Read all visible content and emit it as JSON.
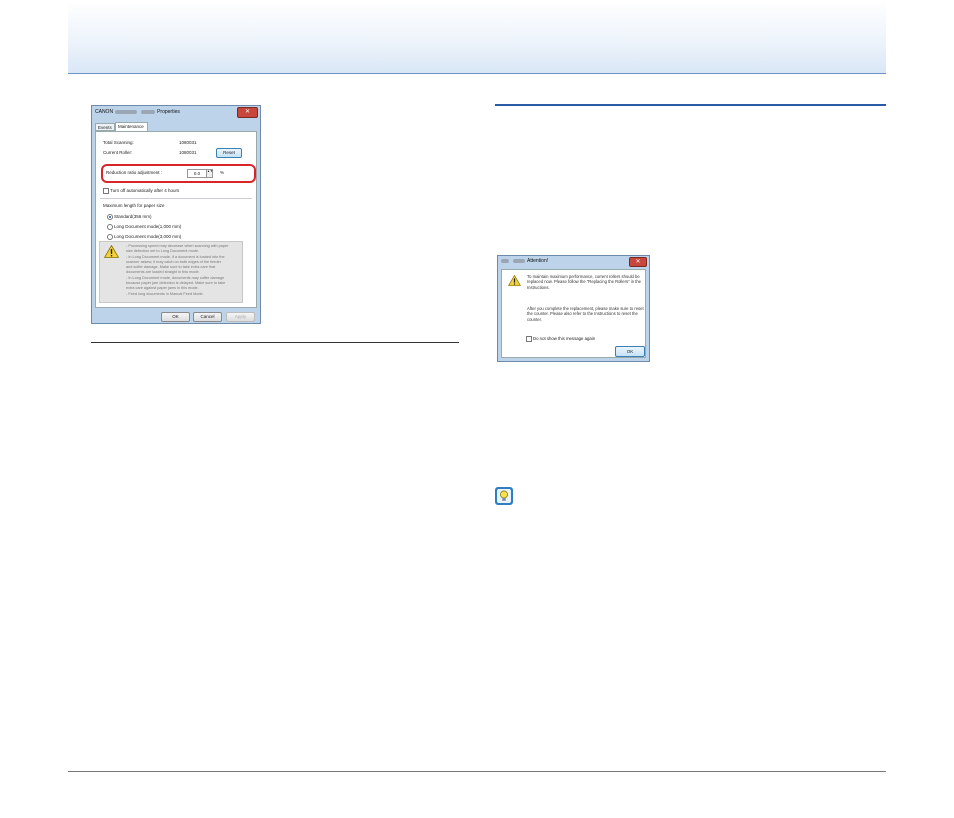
{
  "properties_dialog": {
    "title_left": "CANON",
    "title_right": "Properties",
    "close_label": "✕",
    "tabs": [
      "Events",
      "Maintenance"
    ],
    "total_scanning_label": "Total Scanning:",
    "total_scanning_value": "1080031",
    "current_rollers_label": "Current Roller:",
    "current_rollers_value": "1080031",
    "reset_label": "Reset",
    "reduction_label": "Reduction ratio adjustment :",
    "reduction_value": "0.0",
    "reduction_unit": "%",
    "spin_arrows": "▲▼",
    "auto_off_label": "Turn off automatically after 4 hours",
    "max_length_label": "Maximum length for paper size",
    "radio_options": [
      "Standard(356 mm)",
      "Long Document mode(1,000 mm)",
      "Long Document mode(3,000 mm)"
    ],
    "warning_lines": [
      "- Processing speed may decrease when scanning with paper",
      "size detection set to Long Document mode.",
      "- In Long Document mode, if a document is loaded into the",
      "scanner askew, it may catch on both edges of the feeder",
      "and suffer damage. Make sure to take extra care that",
      "documents are loaded straight in this mode.",
      "- In Long Document mode, documents may suffer damage",
      "because paper jam detection is delayed. Make sure to take",
      "extra care against paper jams in this mode.",
      "- Feed long documents in Manual Feed Mode."
    ],
    "buttons": [
      "OK",
      "Cancel",
      "Apply"
    ]
  },
  "attention_dialog": {
    "title": "Attention!",
    "close_label": "✕",
    "message_1": "To maintain maximum performance, current rollers should be replaced now. Please follow the \"Replacing the Rollers\" in the Instructions.",
    "message_2": "After you complete the replacement, please make sure to reset the counter. Please also refer to the Instructions to reset the counter.",
    "checkbox_label": "Do not show this message again",
    "ok_label": "OK"
  },
  "colors": {
    "highlight": "#d9252a",
    "section_rule": "#2a5aa6",
    "hint_icon": "#2c7fc3"
  },
  "icons": [
    "warning-icon",
    "hint-icon",
    "close-icon"
  ]
}
